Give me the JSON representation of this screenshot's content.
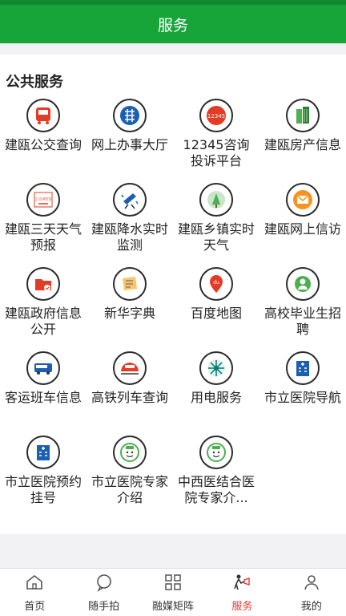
{
  "header": {
    "title": "服务"
  },
  "section": {
    "title": "公共服务"
  },
  "services": [
    {
      "label": "建瓯公交查询",
      "icon": "bus-icon"
    },
    {
      "label": "网上办事大厅",
      "icon": "office-hall-icon"
    },
    {
      "label": "12345咨询投诉平台",
      "icon": "hotline-12345-icon",
      "icon_text": "12345"
    },
    {
      "label": "建瓯房产信息",
      "icon": "building-icon"
    },
    {
      "label": "建瓯三天天气预报",
      "icon": "weather-3days-icon",
      "icon_text": "3 DAYS"
    },
    {
      "label": "建瓯降水实时监测",
      "icon": "rain-monitor-icon"
    },
    {
      "label": "建瓯乡镇实时天气",
      "icon": "town-weather-icon"
    },
    {
      "label": "建瓯网上信访",
      "icon": "mail-icon"
    },
    {
      "label": "建瓯政府信息公开",
      "icon": "folder-icon"
    },
    {
      "label": "新华字典",
      "icon": "dictionary-icon"
    },
    {
      "label": "百度地图",
      "icon": "map-pin-icon",
      "icon_text": "du"
    },
    {
      "label": "高校毕业生招聘",
      "icon": "recruitment-icon"
    },
    {
      "label": "客运班车信息",
      "icon": "coach-icon"
    },
    {
      "label": "高铁列车查询",
      "icon": "train-icon"
    },
    {
      "label": "用电服务",
      "icon": "power-icon"
    },
    {
      "label": "市立医院导航",
      "icon": "hospital-icon"
    },
    {
      "label": "市立医院预约挂号",
      "icon": "hospital-icon"
    },
    {
      "label": "市立医院专家介绍",
      "icon": "doctor-icon"
    },
    {
      "label": "中西医结合医院专家介...",
      "icon": "doctor-icon"
    }
  ],
  "tabbar": {
    "active": "服务",
    "tabs": [
      {
        "label": "首页",
        "icon": "home-icon"
      },
      {
        "label": "随手拍",
        "icon": "chat-bubble-icon"
      },
      {
        "label": "融媒矩阵",
        "icon": "grid-icon"
      },
      {
        "label": "服务",
        "icon": "service-icon"
      },
      {
        "label": "我的",
        "icon": "user-icon"
      }
    ]
  },
  "colors": {
    "brand_green": "#17a53a",
    "active_tab": "#e53935",
    "icon_red": "#e23b26",
    "icon_blue": "#1a5fb4",
    "icon_green": "#4caf50",
    "icon_orange": "#f7931e"
  }
}
